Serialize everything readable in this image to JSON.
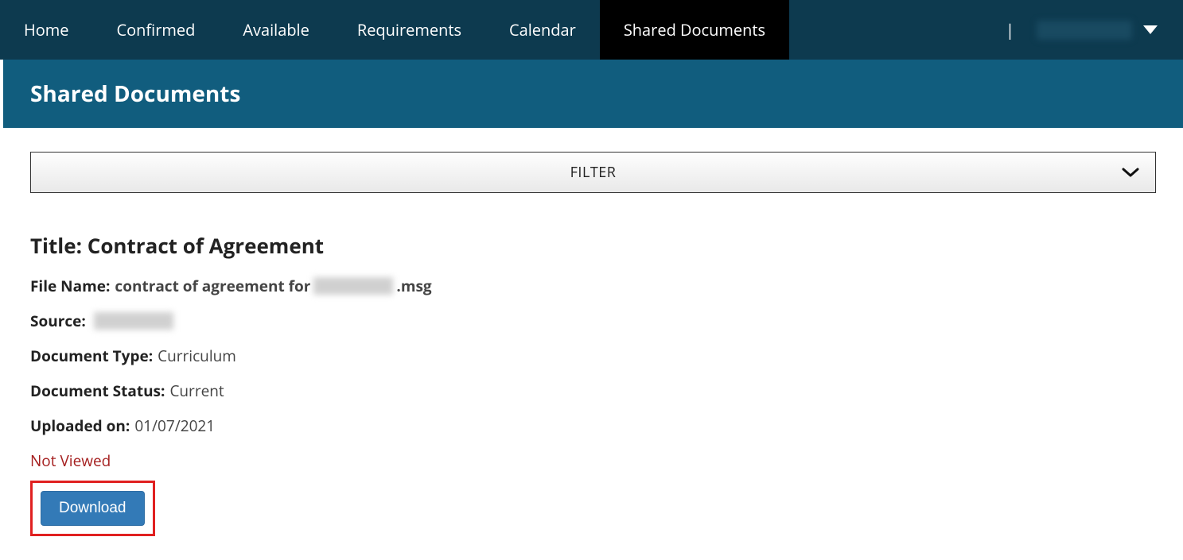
{
  "nav": {
    "items": [
      {
        "label": "Home",
        "active": false
      },
      {
        "label": "Confirmed",
        "active": false
      },
      {
        "label": "Available",
        "active": false
      },
      {
        "label": "Requirements",
        "active": false
      },
      {
        "label": "Calendar",
        "active": false
      },
      {
        "label": "Shared Documents",
        "active": true
      }
    ],
    "divider": "|"
  },
  "page": {
    "heading": "Shared Documents"
  },
  "filter": {
    "label": "FILTER"
  },
  "document": {
    "title_label": "Title:",
    "title_value": "Contract of Agreement",
    "filename_label": "File Name:",
    "filename_prefix": "contract of agreement for",
    "filename_suffix": ".msg",
    "source_label": "Source:",
    "type_label": "Document Type:",
    "type_value": "Curriculum",
    "status_label": "Document Status:",
    "status_value": "Current",
    "uploaded_label": "Uploaded on:",
    "uploaded_value": "01/07/2021",
    "view_state": "Not Viewed",
    "download_label": "Download"
  }
}
